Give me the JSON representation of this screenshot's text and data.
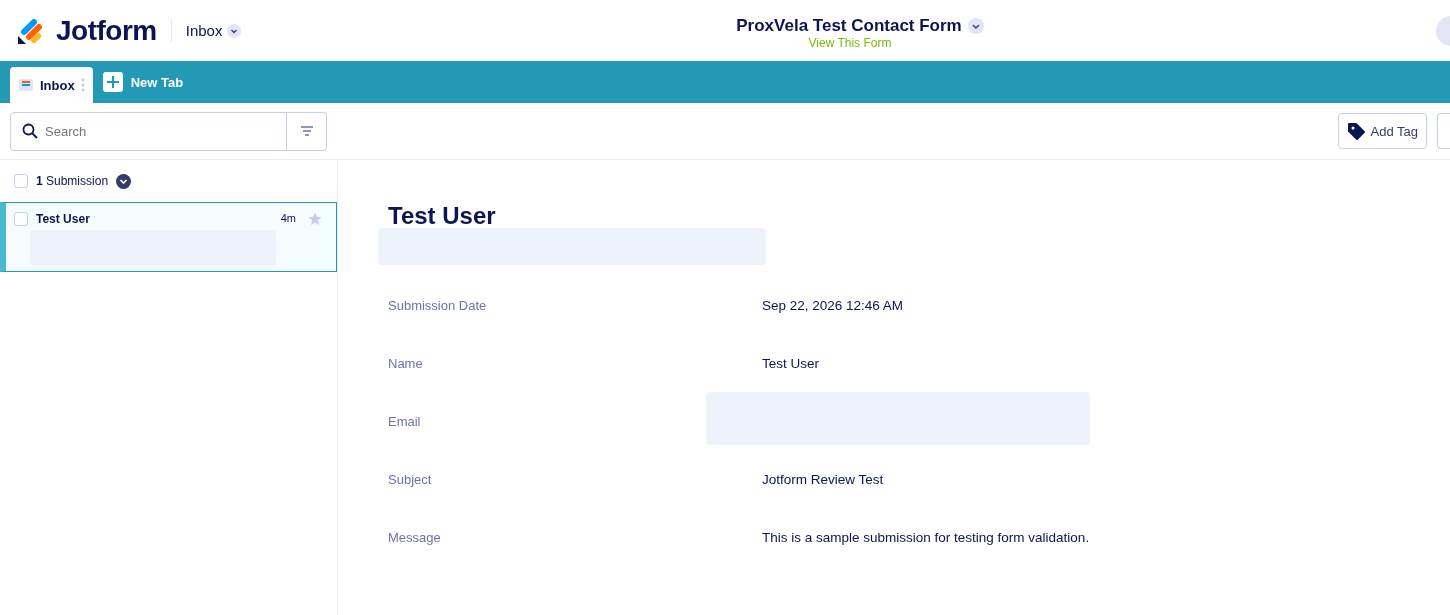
{
  "header": {
    "logo_text": "Jotform",
    "section": "Inbox",
    "form_title": "ProxVela Test Contact Form",
    "form_link": "View This Form"
  },
  "tabs": [
    {
      "label": "Inbox",
      "selected": true
    }
  ],
  "new_tab": "New Tab",
  "toolbar": {
    "search_placeholder": "Search",
    "add_tag": "Add Tag"
  },
  "list": {
    "count": "1",
    "count_label": "Submission",
    "checked": false,
    "items": [
      {
        "name": "Test User",
        "time": "4m",
        "selected": true,
        "checked": false,
        "starred": false
      }
    ]
  },
  "detail": {
    "title": "Test User",
    "fields": [
      {
        "label": "Submission Date",
        "kind": "text",
        "value": "Sep 22, 2026 12:46 AM"
      },
      {
        "label": "Name",
        "kind": "text",
        "value": "Test User"
      },
      {
        "label": "Email",
        "kind": "redacted"
      },
      {
        "label": "Subject",
        "kind": "text",
        "value": "Jotform Review Test"
      },
      {
        "label": "Message",
        "kind": "text",
        "value": "This is a sample submission for testing form validation."
      }
    ]
  }
}
